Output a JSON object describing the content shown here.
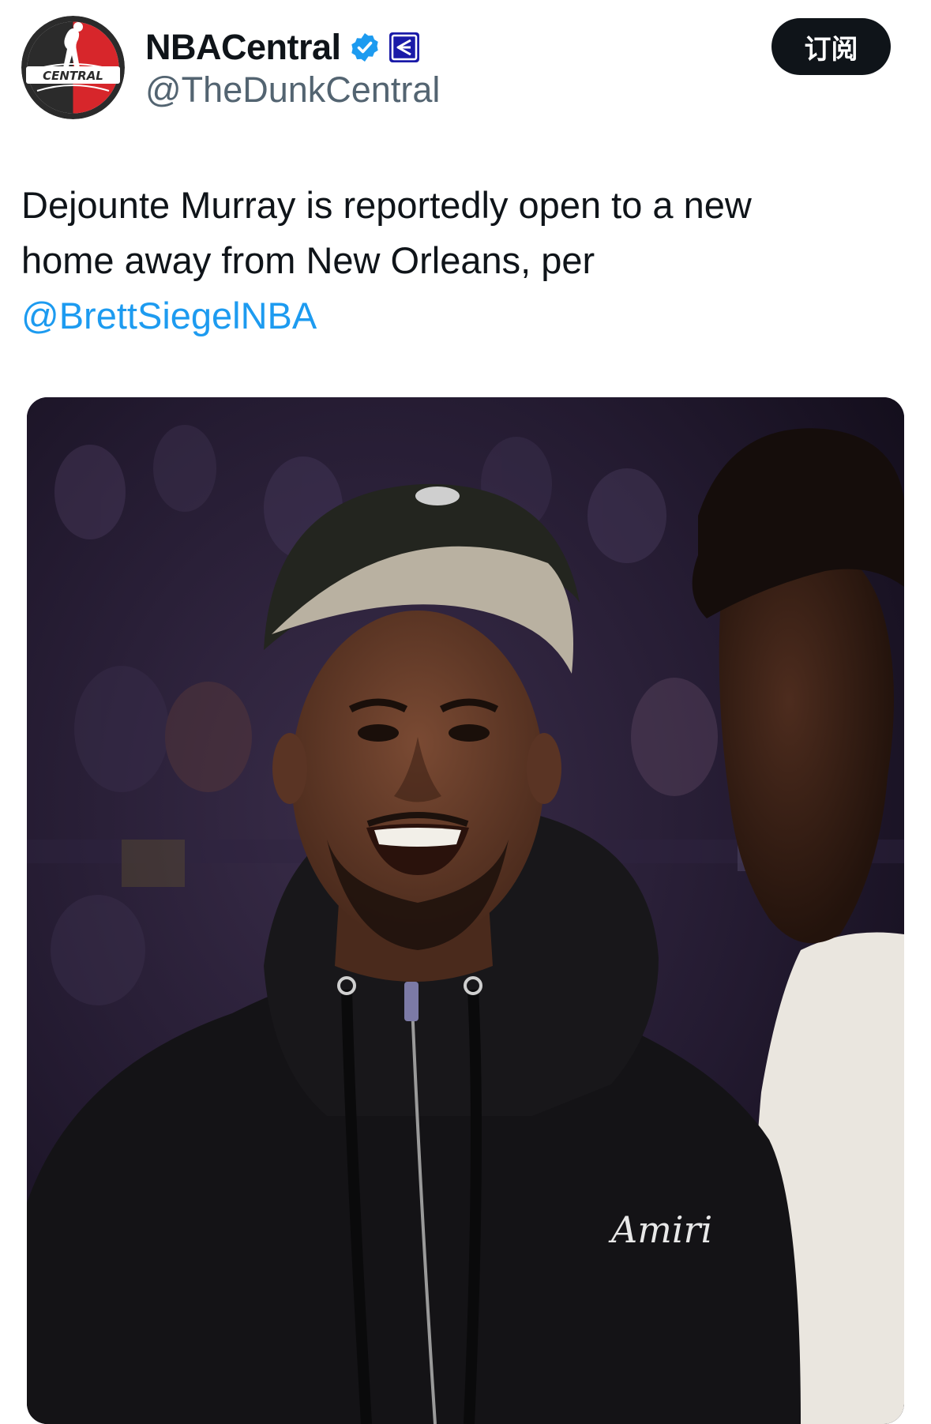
{
  "author": {
    "display_name": "NBACentral",
    "handle": "@TheDunkCentral",
    "avatar_text": "CENTRAL",
    "verified_icon": "verified-badge-icon",
    "affiliate_icon": "affiliate-badge-icon"
  },
  "actions": {
    "subscribe_label": "订阅"
  },
  "tweet": {
    "line1": "Dejounte Murray is reportedly open to a new",
    "line2": "home away from New Orleans, per",
    "mention": "@BrettSiegelNBA"
  },
  "media": {
    "jacket_logo_text": "Amiri"
  },
  "colors": {
    "accent": "#1d9bf0",
    "text": "#0f1419",
    "secondary_text": "#536471",
    "button_bg": "#0f1419"
  }
}
